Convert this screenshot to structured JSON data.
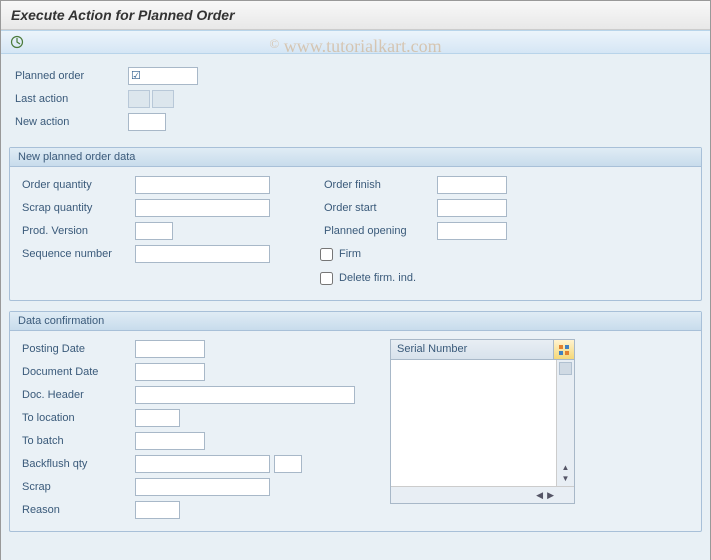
{
  "title": "Execute Action for Planned Order",
  "watermark": "www.tutorialkart.com",
  "toolbar": {
    "execute_icon": "execute"
  },
  "top": {
    "planned_order_label": "Planned order",
    "planned_order_value": "",
    "last_action_label": "Last action",
    "last_action_value1": "",
    "last_action_value2": "",
    "new_action_label": "New action",
    "new_action_value": ""
  },
  "group_new": {
    "title": "New planned order data",
    "order_qty_label": "Order quantity",
    "order_qty_value": "",
    "scrap_qty_label": "Scrap quantity",
    "scrap_qty_value": "",
    "prod_version_label": "Prod. Version",
    "prod_version_value": "",
    "sequence_label": "Sequence number",
    "sequence_value": "",
    "order_finish_label": "Order finish",
    "order_finish_value": "",
    "order_start_label": "Order start",
    "order_start_value": "",
    "planned_open_label": "Planned opening",
    "planned_open_value": "",
    "firm_label": "Firm",
    "delete_firm_label": "Delete firm. ind."
  },
  "group_conf": {
    "title": "Data confirmation",
    "posting_date_label": "Posting Date",
    "posting_date_value": "",
    "document_date_label": "Document Date",
    "document_date_value": "",
    "doc_header_label": "Doc. Header",
    "doc_header_value": "",
    "to_location_label": "To location",
    "to_location_value": "",
    "to_batch_label": "To batch",
    "to_batch_value": "",
    "backflush_label": "Backflush qty",
    "backflush_value": "",
    "backflush_unit": "",
    "scrap_label": "Scrap",
    "scrap_value": "",
    "reason_label": "Reason",
    "reason_value": "",
    "serial_header": "Serial Number"
  }
}
